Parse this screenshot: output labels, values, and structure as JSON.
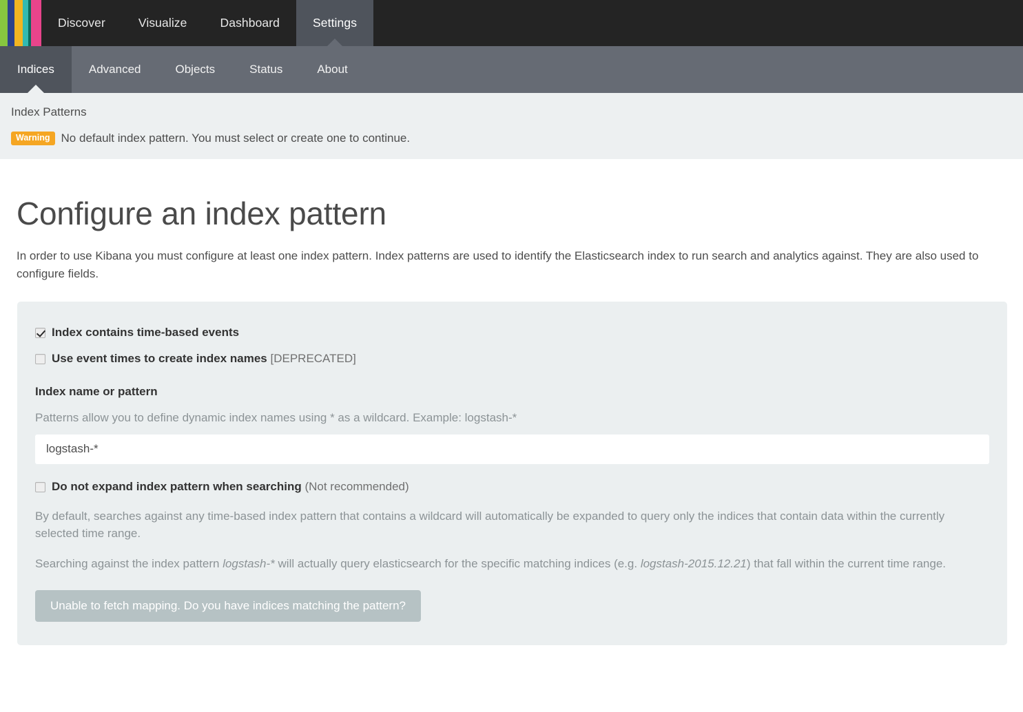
{
  "brand": {
    "stripe_colors": [
      "#87c63f",
      "#2c4289",
      "#f2b521",
      "#33bab1",
      "#0b6b5e",
      "#e8448b"
    ]
  },
  "navbar": {
    "items": [
      {
        "label": "Discover",
        "active": false
      },
      {
        "label": "Visualize",
        "active": false
      },
      {
        "label": "Dashboard",
        "active": false
      },
      {
        "label": "Settings",
        "active": true
      }
    ]
  },
  "subnav": {
    "items": [
      {
        "label": "Indices",
        "active": true
      },
      {
        "label": "Advanced",
        "active": false
      },
      {
        "label": "Objects",
        "active": false
      },
      {
        "label": "Status",
        "active": false
      },
      {
        "label": "About",
        "active": false
      }
    ]
  },
  "strip": {
    "breadcrumb": "Index Patterns",
    "warning_badge": "Warning",
    "warning_message": "No default index pattern. You must select or create one to continue.",
    "warning_color": "#f5a623"
  },
  "main": {
    "title": "Configure an index pattern",
    "description": "In order to use Kibana you must configure at least one index pattern. Index patterns are used to identify the Elasticsearch index to run search and analytics against. They are also used to configure fields."
  },
  "form": {
    "time_based": {
      "label": "Index contains time-based events",
      "checked": true
    },
    "event_times": {
      "label": "Use event times to create index names",
      "suffix": "[DEPRECATED]",
      "checked": false
    },
    "index_name": {
      "label": "Index name or pattern",
      "hint": "Patterns allow you to define dynamic index names using * as a wildcard. Example: logstash-*",
      "value": "logstash-*",
      "placeholder": "logstash-*"
    },
    "no_expand": {
      "label": "Do not expand index pattern when searching",
      "suffix": "(Not recommended)",
      "checked": false
    },
    "expand_explainer": "By default, searches against any time-based index pattern that contains a wildcard will automatically be expanded to query only the indices that contain data within the currently selected time range.",
    "search_explainer": {
      "part1": "Searching against the index pattern ",
      "em1": "logstash-*",
      "part2": " will actually query elasticsearch for the specific matching indices (e.g. ",
      "em2": "logstash-2015.12.21",
      "part3": ") that fall within the current time range."
    },
    "submit_button": {
      "label": "Unable to fetch mapping. Do you have indices matching the pattern?",
      "disabled": true
    }
  }
}
